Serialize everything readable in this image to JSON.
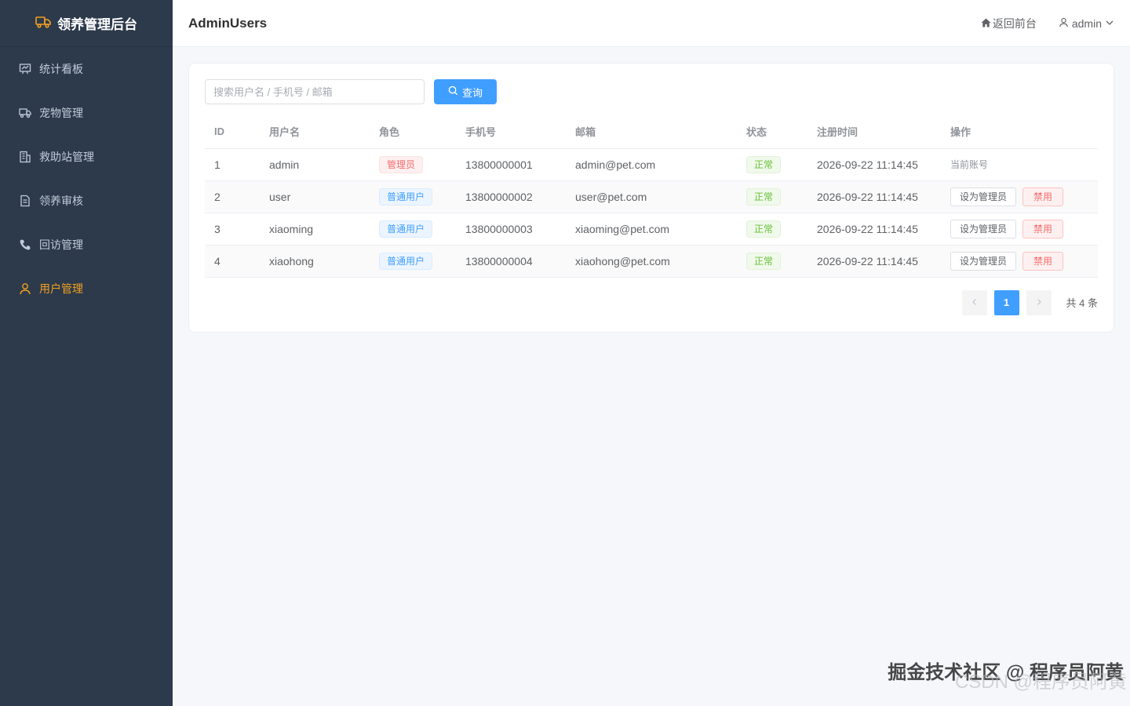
{
  "brand": {
    "title": "领养管理后台",
    "icon": "truck-icon",
    "accent": "#f0a020"
  },
  "sidebar": {
    "items": [
      {
        "label": "统计看板",
        "icon": "presentation-board-icon"
      },
      {
        "label": "宠物管理",
        "icon": "truck-icon"
      },
      {
        "label": "救助站管理",
        "icon": "office-building-icon"
      },
      {
        "label": "领养审核",
        "icon": "document-icon"
      },
      {
        "label": "回访管理",
        "icon": "phone-icon"
      },
      {
        "label": "用户管理",
        "icon": "user-icon",
        "active": true
      }
    ]
  },
  "header": {
    "title": "AdminUsers",
    "back_label": "返回前台",
    "user_label": "admin"
  },
  "search": {
    "placeholder": "搜索用户名 / 手机号 / 邮箱",
    "value": "",
    "button_label": "查询"
  },
  "table": {
    "columns": [
      "ID",
      "用户名",
      "角色",
      "手机号",
      "邮箱",
      "状态",
      "注册时间",
      "操作"
    ],
    "rows": [
      {
        "id": "1",
        "username": "admin",
        "role": "管理员",
        "role_type": "danger",
        "phone": "13800000001",
        "email": "admin@pet.com",
        "status": "正常",
        "registered": "2026-09-22 11:14:45",
        "action_text": "当前账号"
      },
      {
        "id": "2",
        "username": "user",
        "role": "普通用户",
        "role_type": "primary",
        "phone": "13800000002",
        "email": "user@pet.com",
        "status": "正常",
        "registered": "2026-09-22 11:14:45",
        "set_admin_label": "设为管理员",
        "disable_label": "禁用"
      },
      {
        "id": "3",
        "username": "xiaoming",
        "role": "普通用户",
        "role_type": "primary",
        "phone": "13800000003",
        "email": "xiaoming@pet.com",
        "status": "正常",
        "registered": "2026-09-22 11:14:45",
        "set_admin_label": "设为管理员",
        "disable_label": "禁用"
      },
      {
        "id": "4",
        "username": "xiaohong",
        "role": "普通用户",
        "role_type": "primary",
        "phone": "13800000004",
        "email": "xiaohong@pet.com",
        "status": "正常",
        "registered": "2026-09-22 11:14:45",
        "set_admin_label": "设为管理员",
        "disable_label": "禁用"
      }
    ]
  },
  "pagination": {
    "current_page": "1",
    "total_text": "共 4 条"
  },
  "watermark": {
    "line1": "掘金技术社区 @ 程序员阿黄",
    "line2": "CSDN @程序员阿黄"
  },
  "colors": {
    "sidebar_bg": "#2d3a4b",
    "primary": "#409eff",
    "danger": "#f56c6c",
    "success": "#67c23a"
  }
}
